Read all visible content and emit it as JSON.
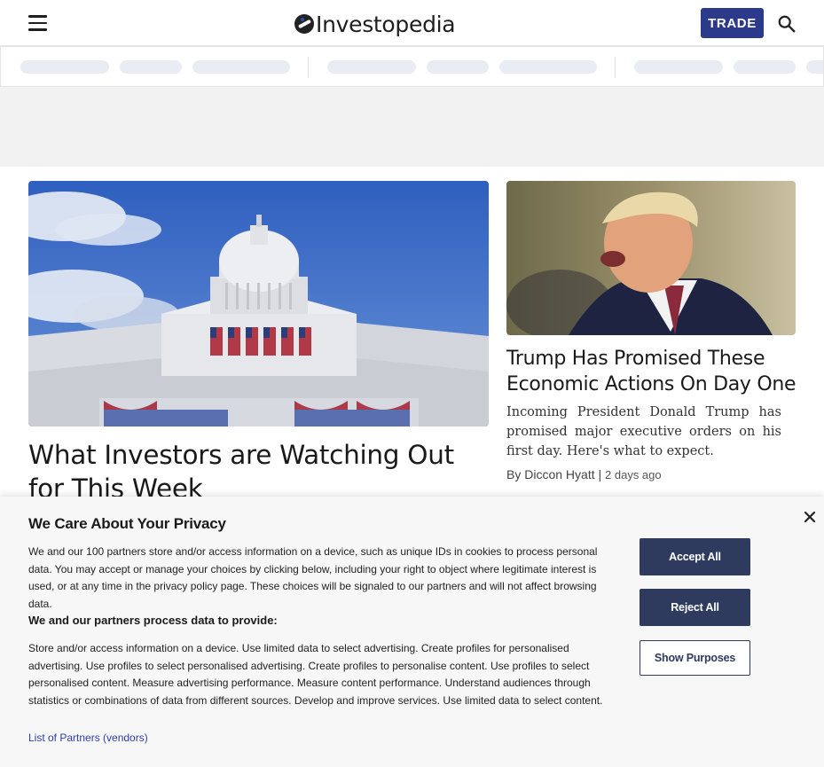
{
  "header": {
    "logo_text": "Investopedia",
    "trade_label": "TRADE",
    "accent_color": "#2c3a8c"
  },
  "icons": {
    "menu": "hamburger-icon",
    "search": "search-icon",
    "close": "close-icon"
  },
  "featured": {
    "title": "What Investors are Watching Out for This Week",
    "image": "us-capitol-building-photo"
  },
  "side_article": {
    "title": "Trump Has Promised These Economic Actions On Day One",
    "description": "Incoming President Donald Trump has promised major executive orders on his first day. Here's what to expect.",
    "author_prefix": "By",
    "author": "Diccon Hyatt",
    "separator": "|",
    "date": "2 days ago",
    "image": "donald-trump-photo"
  },
  "privacy": {
    "title": "We Care About Your Privacy",
    "body": "We and our 100 partners store and/or access information on a device, such as unique IDs in cookies to process personal data. You may accept or manage your choices by clicking below, including your right to object where legitimate interest is used, or at any time in the privacy policy page. These choices will be signaled to our partners and will not affect browsing data.",
    "subtitle": "We and our partners process data to provide:",
    "purposes": "Store and/or access information on a device. Use limited data to select advertising. Create profiles for personalised advertising. Use profiles to select personalised advertising. Create profiles to personalise content. Use profiles to select personalised content. Measure advertising performance. Measure content performance. Understand audiences through statistics or combinations of data from different sources. Develop and improve services. Use limited data to select content.",
    "partners_link": "List of Partners (vendors)",
    "accept_label": "Accept All",
    "reject_label": "Reject All",
    "purposes_label": "Show Purposes"
  }
}
